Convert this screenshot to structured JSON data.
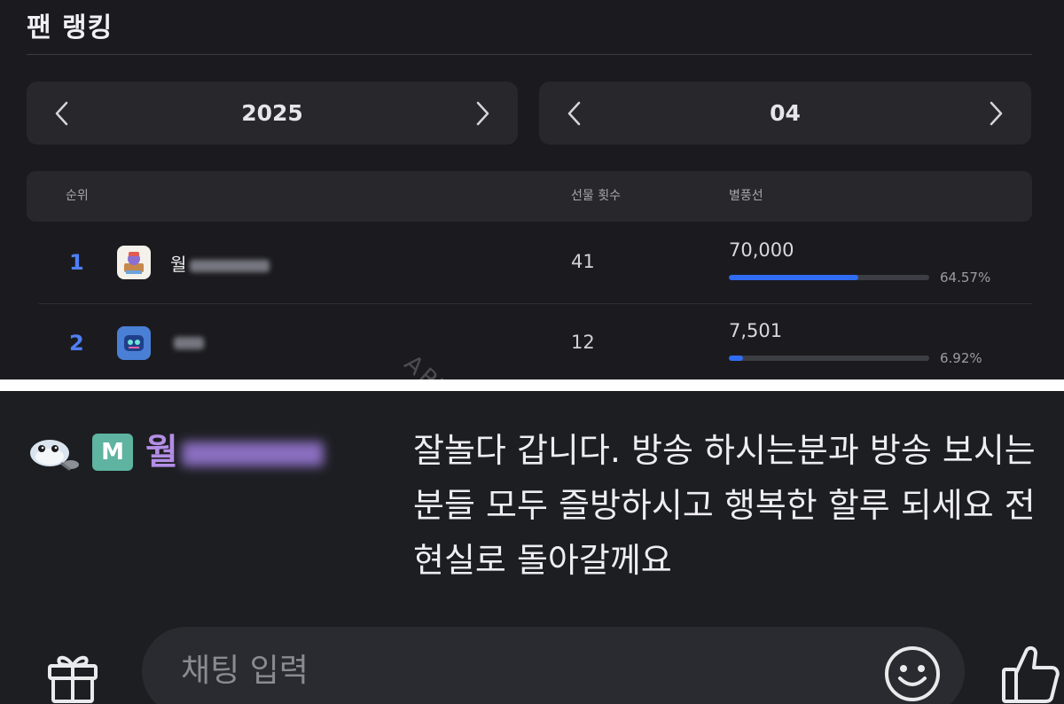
{
  "ranking": {
    "title": "팬 랭킹",
    "year": "2025",
    "month": "04",
    "columns": {
      "rank": "순위",
      "gifts": "선물 횟수",
      "stars": "별풍선"
    },
    "rows": [
      {
        "rank": "1",
        "name": "월",
        "gifts": "41",
        "stars": "70,000",
        "percent": "64.57%",
        "share": 0.6457
      },
      {
        "rank": "2",
        "name": "",
        "gifts": "12",
        "stars": "7,501",
        "percent": "6.92%",
        "share": 0.0692
      }
    ]
  },
  "watermark": "ARTIVENEWS",
  "chat": {
    "badge": "M",
    "username": "월",
    "message": "잘놀다 갑니다. 방송 하시는분과 방송 보시는 분들 모두 즐방하시고 행복한 할루 되세요 전 현실로 돌아갈께요",
    "input_placeholder": "채팅 입력"
  },
  "colors": {
    "accent": "#2f6cf2",
    "rank": "#4f7ff5",
    "username": "#b48ee6",
    "badge": "#5fb3a1"
  },
  "icons": {
    "prev": "chevron-left-icon",
    "next": "chevron-right-icon",
    "gift": "gift-icon",
    "emoji": "smiley-icon",
    "like": "thumbs-up-icon"
  }
}
